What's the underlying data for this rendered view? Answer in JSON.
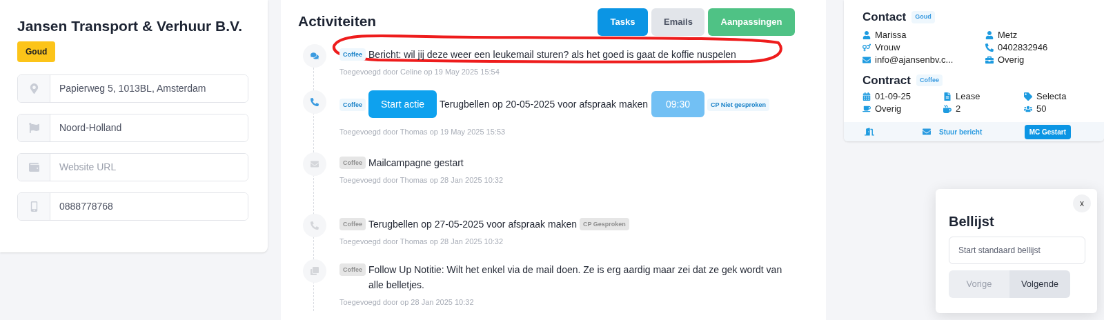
{
  "company": {
    "name": "Jansen Transport & Verhuur B.V.",
    "tier": "Goud"
  },
  "fields": [
    {
      "kind": "address",
      "value": "Papierweg 5, 1013BL, Amsterdam"
    },
    {
      "kind": "region",
      "value": "Noord-Holland"
    },
    {
      "kind": "website",
      "placeholder": "Website URL"
    },
    {
      "kind": "phone",
      "value": "0888778768"
    }
  ],
  "activities": {
    "title": "Activiteiten",
    "tabs": [
      {
        "label": "Tasks",
        "color": "#0b95e4"
      },
      {
        "label": "Emails",
        "color": "#e2e5ea"
      },
      {
        "label": "Aanpassingen",
        "color": "#4fc285"
      }
    ],
    "items": [
      {
        "kind": "message",
        "tag": "Coffee",
        "active": true,
        "text": "Bericht: wil jij deze weer een leukemail sturen? als het goed is gaat de koffie nuspelen",
        "meta": "Toegevoegd door Celine op 19 May 2025 15:54"
      },
      {
        "kind": "call",
        "tag": "Coffee",
        "active": true,
        "action": "Start actie",
        "text": "Terugbellen op 20-05-2025 voor afspraak maken",
        "time": "09:30",
        "status": "CP Niet gesproken",
        "meta": "Toegevoegd door Thomas op 19 May 2025 15:53"
      },
      {
        "kind": "mail",
        "tag": "Coffee",
        "active": false,
        "text": "Mailcampagne gestart",
        "meta": "Toegevoegd door Thomas op 28 Jan 2025 10:32"
      },
      {
        "kind": "call",
        "tag": "Coffee",
        "active": false,
        "text": "Terugbellen op 27-05-2025 voor afspraak maken",
        "status": "CP Gesproken",
        "meta": "Toegevoegd door Thomas op 28 Jan 2025 10:32"
      },
      {
        "kind": "note",
        "tag": "Coffee",
        "active": false,
        "text": "Follow Up Notitie: Wilt het enkel via de mail doen. Ze is erg aardig maar zei dat ze gek wordt van alle belletjes.",
        "meta": "Toegevoegd door op 28 Jan 2025 10:32"
      }
    ]
  },
  "contact": {
    "title": "Contact",
    "badge": "Goud",
    "fields": [
      {
        "kind": "person",
        "text": "Marissa"
      },
      {
        "kind": "person",
        "text": "Metz"
      },
      {
        "kind": "gender",
        "text": "Vrouw"
      },
      {
        "kind": "phone",
        "text": "0402832946"
      },
      {
        "kind": "email",
        "text": "info@ajansenbv.c..."
      },
      {
        "kind": "work",
        "text": "Overig"
      }
    ]
  },
  "contract": {
    "title": "Contract",
    "badge": "Coffee",
    "fields": [
      {
        "kind": "date",
        "text": "01-09-25"
      },
      {
        "kind": "file",
        "text": "Lease"
      },
      {
        "kind": "tag",
        "text": "Selecta"
      },
      {
        "kind": "coffee",
        "text": "Overig"
      },
      {
        "kind": "cup",
        "text": "2"
      },
      {
        "kind": "people",
        "text": "50"
      }
    ]
  },
  "footer": {
    "message_link": "Stuur bericht",
    "status_badge": "MC Gestart"
  },
  "bellijst": {
    "title": "Bellijst",
    "close": "x",
    "placeholder": "Start standaard bellijst",
    "buttons": [
      {
        "label": "Vorige",
        "disabled": true
      },
      {
        "label": "Volgende",
        "disabled": false
      }
    ]
  }
}
